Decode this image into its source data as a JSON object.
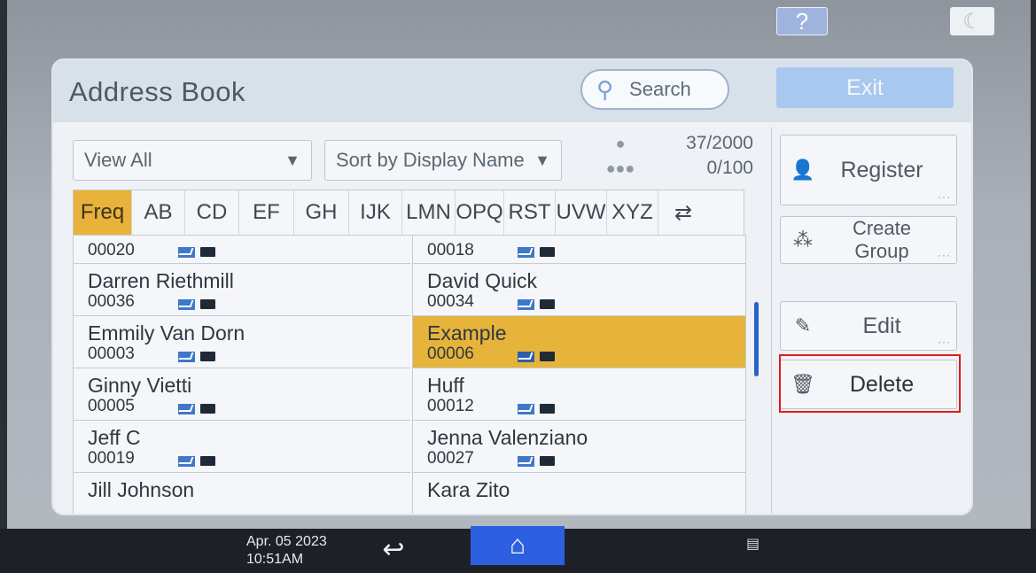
{
  "topbar": {
    "help_label": "?",
    "sleep_icon": "moon-icon"
  },
  "header": {
    "title": "Address Book",
    "search_label": "Search",
    "exit_label": "Exit"
  },
  "filters": {
    "view": "View All",
    "sort": "Sort by Display Name"
  },
  "counters": {
    "entries": "37/2000",
    "groups": "0/100"
  },
  "tabs": [
    "Freq",
    "AB",
    "CD",
    "EF",
    "GH",
    "IJK",
    "LMN",
    "OPQ",
    "RST",
    "UVW",
    "XYZ"
  ],
  "tab_switch_icon": "swap-arrows-icon",
  "list": {
    "left": [
      {
        "name": "",
        "num": "00020"
      },
      {
        "name": "Darren Riethmill",
        "num": "00036"
      },
      {
        "name": "Emmily Van Dorn",
        "num": "00003"
      },
      {
        "name": "Ginny Vietti",
        "num": "00005"
      },
      {
        "name": "Jeff C",
        "num": "00019"
      },
      {
        "name": "Jill Johnson",
        "num": ""
      }
    ],
    "right": [
      {
        "name": "",
        "num": "00018"
      },
      {
        "name": "David Quick",
        "num": "00034"
      },
      {
        "name": "Example",
        "num": "00006",
        "selected": true
      },
      {
        "name": "Huff",
        "num": "00012"
      },
      {
        "name": "Jenna Valenziano",
        "num": "00027"
      },
      {
        "name": "Kara Zito",
        "num": ""
      }
    ]
  },
  "actions": {
    "register": "Register",
    "create_group": "Create Group",
    "edit": "Edit",
    "delete": "Delete"
  },
  "footer": {
    "date": "Apr. 05 2023",
    "time": "10:51AM"
  },
  "colors": {
    "accent_selected": "#e6b43b",
    "exit_button": "#a9c8ef",
    "home_button": "#2e5fe0",
    "highlight_box": "#e11b1b"
  }
}
